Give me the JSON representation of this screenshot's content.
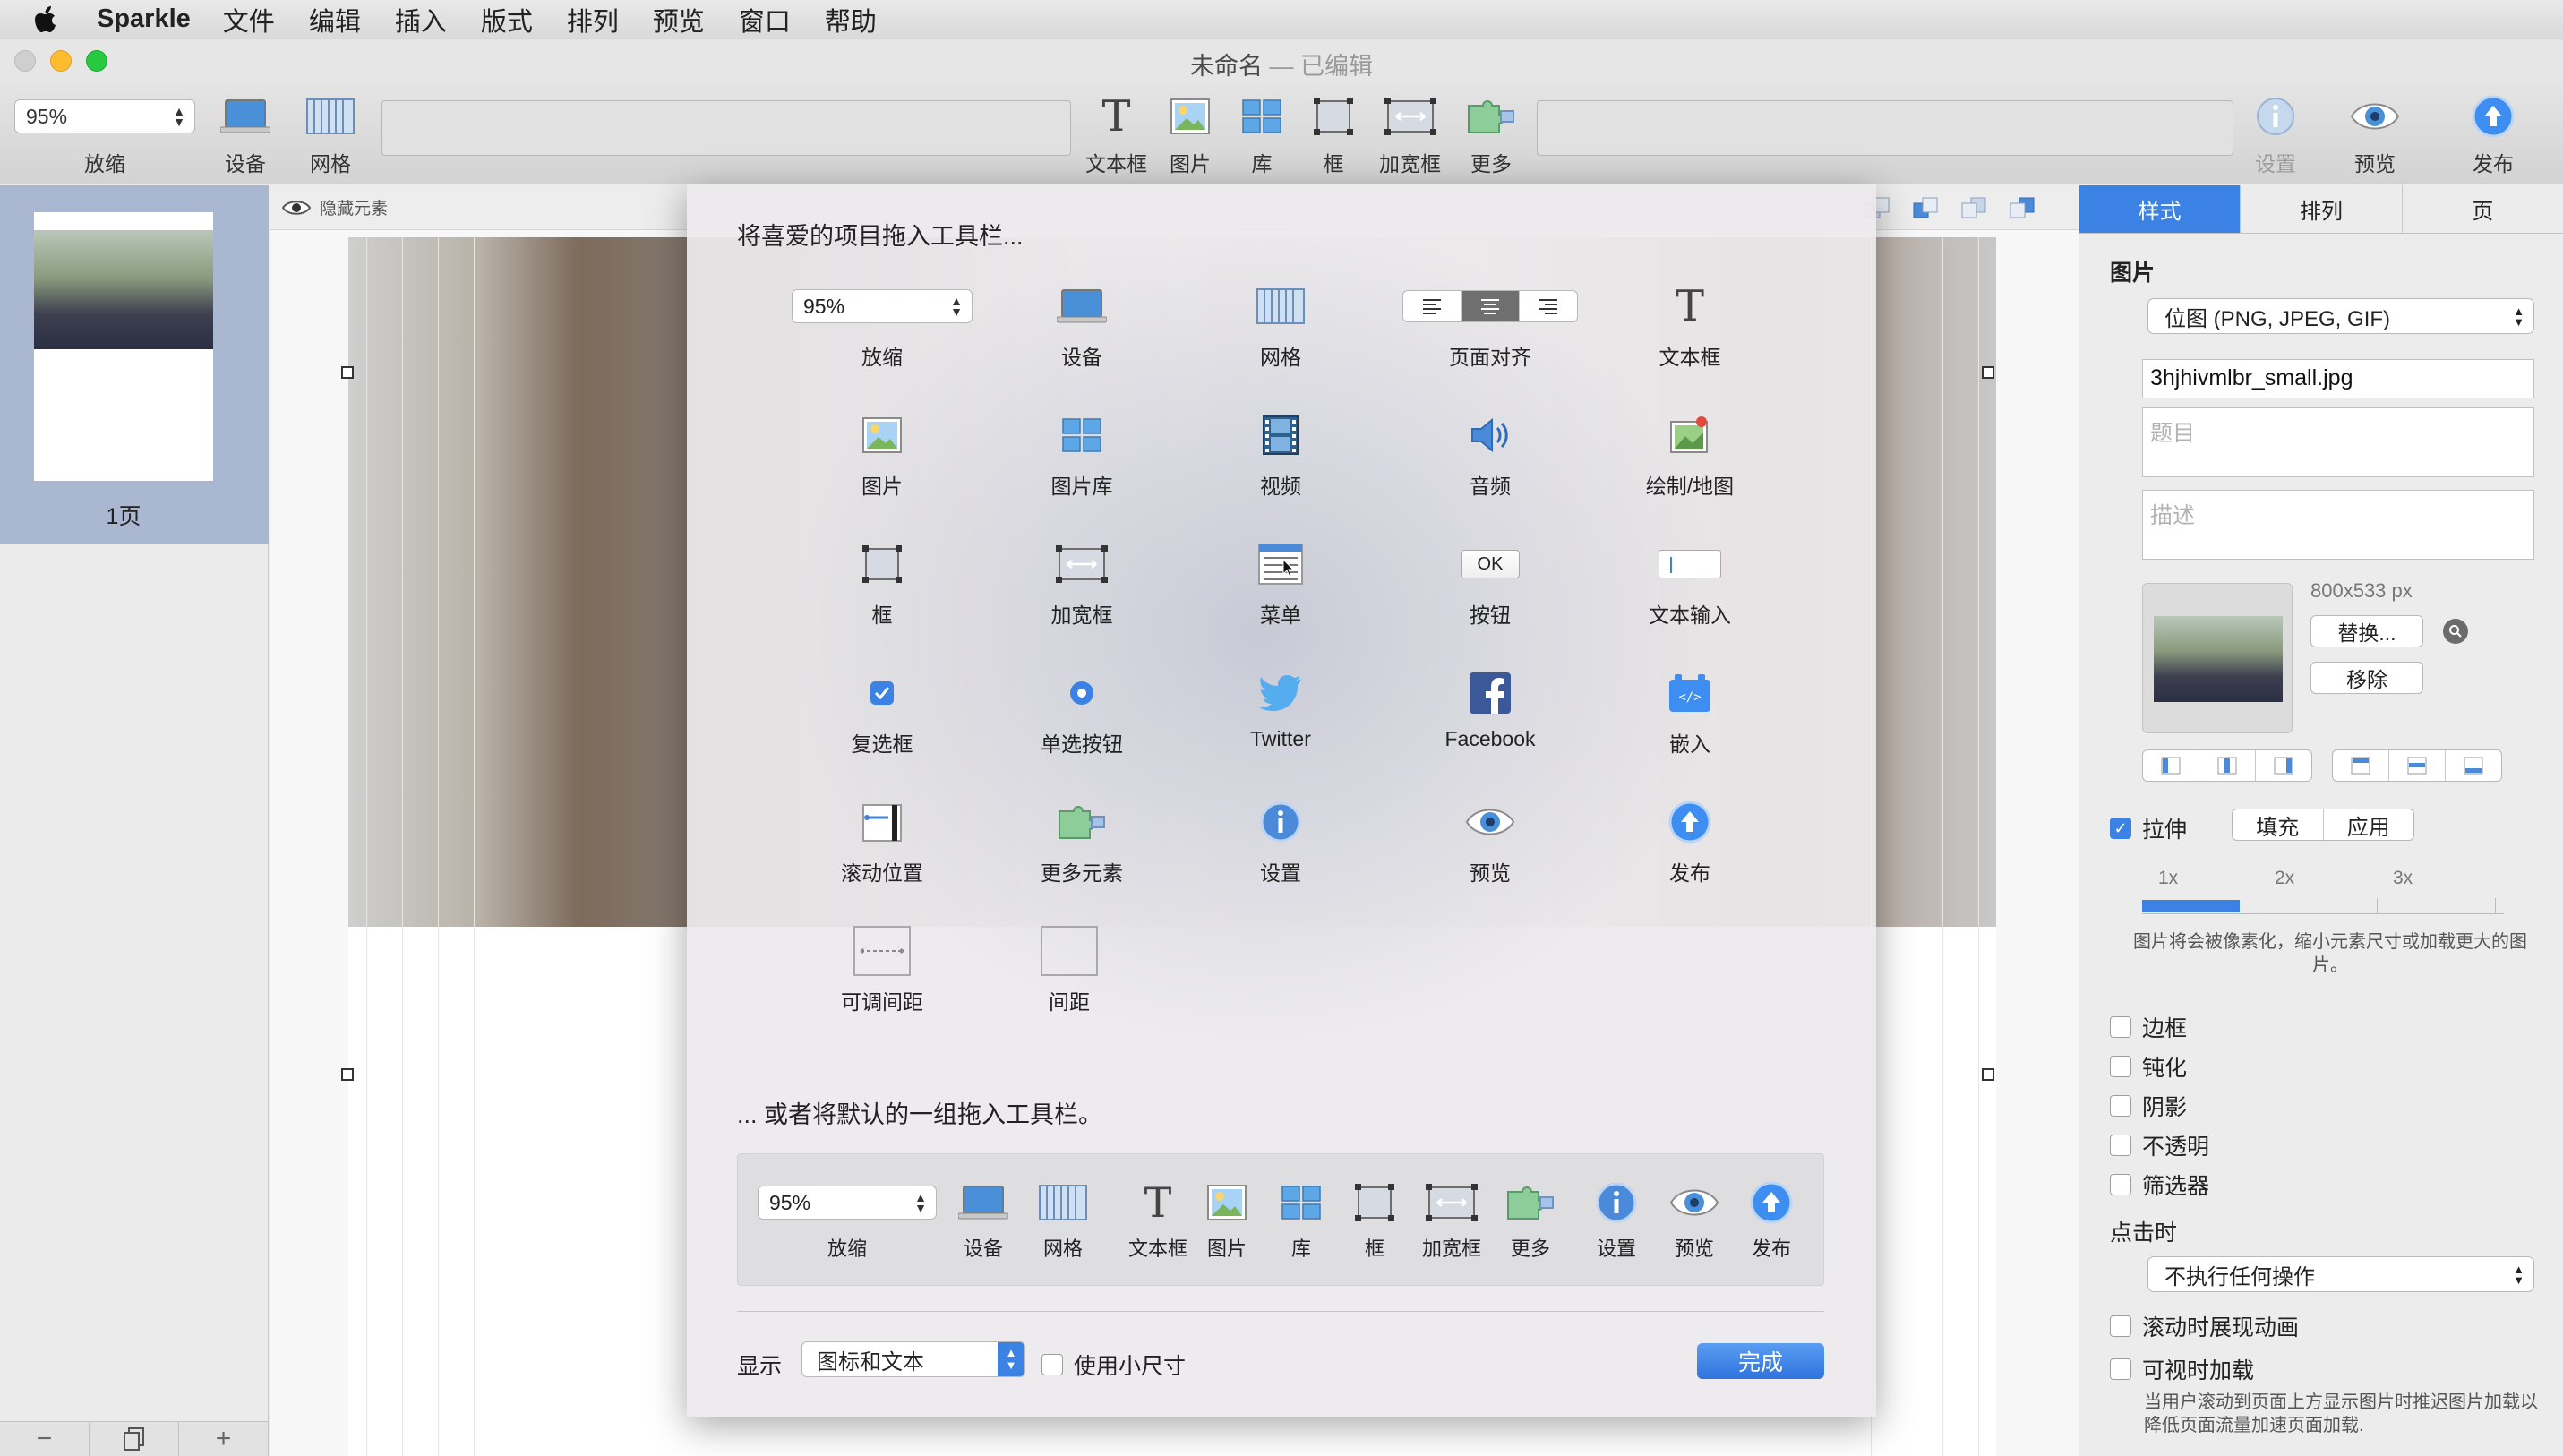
{
  "menubar": {
    "app_name": "Sparkle",
    "items": [
      "文件",
      "编辑",
      "插入",
      "版式",
      "排列",
      "预览",
      "窗口",
      "帮助"
    ]
  },
  "window": {
    "title": "未命名",
    "edited": "— 已编辑"
  },
  "toolbar": {
    "zoom_value": "95%",
    "zoom_label": "放缩",
    "device_label": "设备",
    "grid_label": "网格",
    "textbox_label": "文本框",
    "image_label": "图片",
    "library_label": "库",
    "frame_label": "框",
    "wideframe_label": "加宽框",
    "more_label": "更多",
    "settings_label": "设置",
    "preview_label": "预览",
    "publish_label": "发布"
  },
  "pages": {
    "items": [
      {
        "label": "1页"
      }
    ]
  },
  "canvas": {
    "hide_elements": "隐藏元素"
  },
  "sheet": {
    "title": "将喜爱的项目拖入工具栏...",
    "zoom_value": "95%",
    "items": {
      "zoom": "放缩",
      "device": "设备",
      "grid": "网格",
      "page_align": "页面对齐",
      "textbox": "文本框",
      "image": "图片",
      "gallery": "图片库",
      "video": "视频",
      "audio": "音频",
      "draw_map": "绘制/地图",
      "frame": "框",
      "wide_frame": "加宽框",
      "menu": "菜单",
      "button": "按钮",
      "ok_text": "OK",
      "text_input": "文本输入",
      "checkbox": "复选框",
      "radio": "单选按钮",
      "twitter": "Twitter",
      "facebook": "Facebook",
      "embed": "嵌入",
      "scroll_pos": "滚动位置",
      "more_elements": "更多元素",
      "settings": "设置",
      "preview": "预览",
      "publish": "发布",
      "flex_space": "可调间距",
      "space": "间距"
    },
    "or_text": "... 或者将默认的一组拖入工具栏。",
    "default_set": {
      "zoom_value": "95%",
      "labels": [
        "放缩",
        "设备",
        "网格",
        "文本框",
        "图片",
        "库",
        "框",
        "加宽框",
        "更多",
        "设置",
        "预览",
        "发布"
      ]
    },
    "show_label": "显示",
    "show_value": "图标和文本",
    "small_size": "使用小尺寸",
    "done": "完成"
  },
  "inspector": {
    "tabs": [
      "样式",
      "排列",
      "页"
    ],
    "section_image": "图片",
    "image_type": "位图 (PNG, JPEG, GIF)",
    "filename": "3hjhivmlbr_small.jpg",
    "title_placeholder": "题目",
    "desc_placeholder": "描述",
    "dimensions": "800x533 px",
    "replace": "替换...",
    "remove": "移除",
    "stretch": "拉伸",
    "fill": "填充",
    "apply": "应用",
    "scale_ticks": [
      "1x",
      "2x",
      "3x"
    ],
    "scale_fraction": 0.27,
    "pixel_note": "图片将会被像素化，缩小元素尺寸或加载更大的图片。",
    "checks": [
      "边框",
      "钝化",
      "阴影",
      "不透明",
      "筛选器"
    ],
    "on_click_title": "点击时",
    "on_click_value": "不执行任何操作",
    "scroll_animate": "滚动时展现动画",
    "lazy_load": "可视时加载",
    "lazy_note": "当用户滚动到页面上方显示图片时推迟图片加载以降低页面流量加速页面加载."
  },
  "colors": {
    "accent": "#3b82e4",
    "selected_page_bg": "#a9b7d0",
    "close": "#fe5f57",
    "minimize": "#febc2e",
    "zoom": "#28c840"
  }
}
